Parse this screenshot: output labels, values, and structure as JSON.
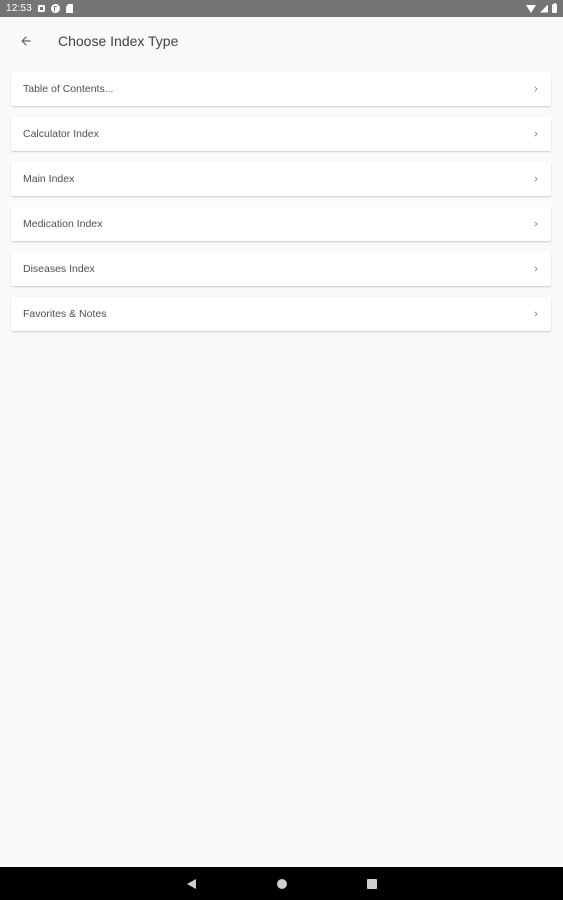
{
  "status_bar": {
    "time": "12:53",
    "notification_icons": [
      "notification-square-icon",
      "notification-circle-icon",
      "sd-card-icon"
    ],
    "system_icons": [
      "wifi-icon",
      "signal-icon",
      "battery-icon"
    ],
    "background_color": "#757575"
  },
  "app_bar": {
    "back_icon": "arrow-back-icon",
    "title": "Choose Index Type"
  },
  "index_list": {
    "items": [
      {
        "label": "Table of Contents..."
      },
      {
        "label": "Calculator Index"
      },
      {
        "label": "Main Index"
      },
      {
        "label": "Medication Index"
      },
      {
        "label": "Diseases Index"
      },
      {
        "label": "Favorites & Notes"
      }
    ],
    "trailing_icon": "chevron-right-icon"
  },
  "nav_bar": {
    "buttons": [
      "nav-back-icon",
      "nav-home-icon",
      "nav-recents-icon"
    ],
    "background_color": "#000000"
  }
}
